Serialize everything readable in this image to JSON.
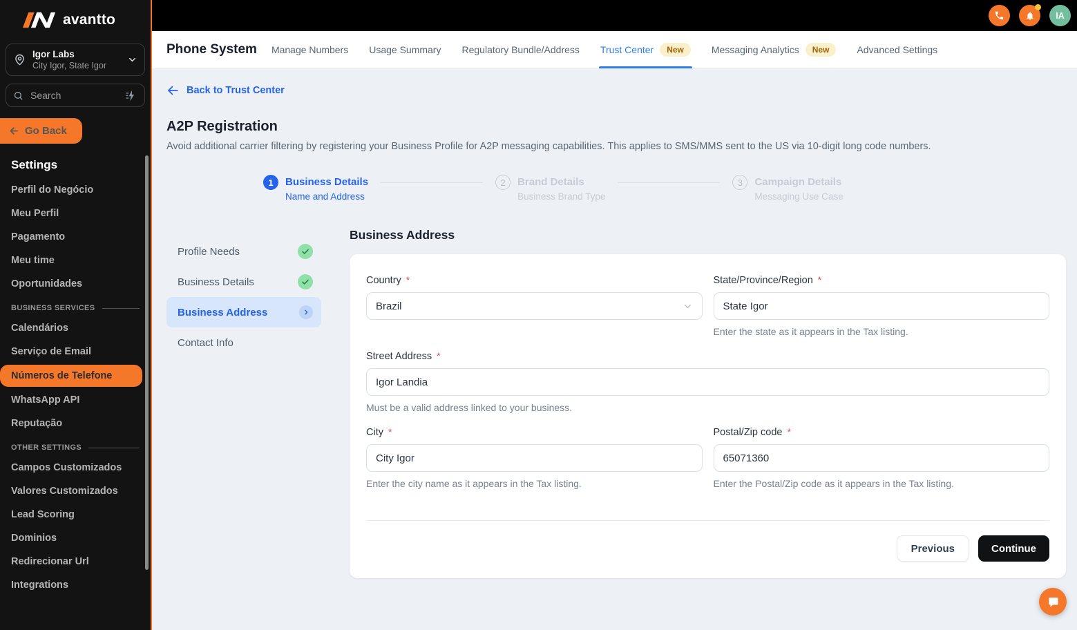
{
  "colors": {
    "accent_orange": "#F4772A",
    "accent_blue": "#2563EB",
    "sidebar_bg": "#131313",
    "main_bg": "#EDF1F6",
    "badge_bg": "#FAF0CC",
    "badge_text": "#A16207",
    "avatar_bg": "#72BE9F"
  },
  "brand": {
    "logo_text": "avantto"
  },
  "topbar": {
    "avatar_initials": "IA"
  },
  "sidebar": {
    "location": {
      "name": "Igor Labs",
      "detail": "City Igor, State Igor"
    },
    "search_placeholder": "Search",
    "go_back_label": "Go Back",
    "settings_heading": "Settings",
    "sections": [
      "BUSINESS SERVICES",
      "OTHER SETTINGS"
    ],
    "menu": [
      {
        "label": "Perfil do Negócio"
      },
      {
        "label": "Meu Perfil"
      },
      {
        "label": "Pagamento"
      },
      {
        "label": "Meu time"
      },
      {
        "label": "Oportunidades"
      },
      {
        "label": "Calendários"
      },
      {
        "label": "Serviço de Email"
      },
      {
        "label": "Números de Telefone",
        "active": true
      },
      {
        "label": "WhatsApp API"
      },
      {
        "label": "Reputação"
      },
      {
        "label": "Campos Customizados"
      },
      {
        "label": "Valores Customizados"
      },
      {
        "label": "Lead Scoring"
      },
      {
        "label": "Dominios"
      },
      {
        "label": "Redirecionar Url"
      },
      {
        "label": "Integrations"
      }
    ]
  },
  "tabbar": {
    "title": "Phone System",
    "tabs": [
      {
        "label": "Manage Numbers"
      },
      {
        "label": "Usage Summary"
      },
      {
        "label": "Regulatory Bundle/Address"
      },
      {
        "label": "Trust Center",
        "badge": "New",
        "active": true
      },
      {
        "label": "Messaging Analytics",
        "badge": "New"
      },
      {
        "label": "Advanced Settings"
      }
    ]
  },
  "page": {
    "back_link": "Back to Trust Center",
    "title": "A2P Registration",
    "description": "Avoid additional carrier filtering by registering your Business Profile for A2P messaging capabilities. This applies to SMS/MMS sent to the US via 10-digit long code numbers."
  },
  "stepper": {
    "steps": [
      {
        "number": "1",
        "title": "Business Details",
        "subtitle": "Name and Address",
        "state": "active"
      },
      {
        "number": "2",
        "title": "Brand Details",
        "subtitle": "Business Brand Type",
        "state": "future"
      },
      {
        "number": "3",
        "title": "Campaign Details",
        "subtitle": "Messaging Use Case",
        "state": "future"
      }
    ]
  },
  "substeps": [
    {
      "label": "Profile Needs",
      "status": "done"
    },
    {
      "label": "Business Details",
      "status": "done"
    },
    {
      "label": "Business Address",
      "status": "active"
    },
    {
      "label": "Contact Info",
      "status": "none"
    }
  ],
  "form": {
    "heading": "Business Address",
    "required_mark": "*",
    "fields": {
      "country": {
        "label": "Country",
        "value": "Brazil"
      },
      "state": {
        "label": "State/Province/Region",
        "value": "State Igor",
        "helper": "Enter the state as it appears in the Tax listing."
      },
      "street": {
        "label": "Street Address",
        "value": "Igor Landia",
        "helper": "Must be a valid address linked to your business."
      },
      "city": {
        "label": "City",
        "value": "City Igor",
        "helper": "Enter the city name as it appears in the Tax listing."
      },
      "postal": {
        "label": "Postal/Zip code",
        "value": "65071360",
        "helper": "Enter the Postal/Zip code as it appears in the Tax listing."
      }
    },
    "buttons": {
      "previous": "Previous",
      "continue": "Continue"
    }
  }
}
